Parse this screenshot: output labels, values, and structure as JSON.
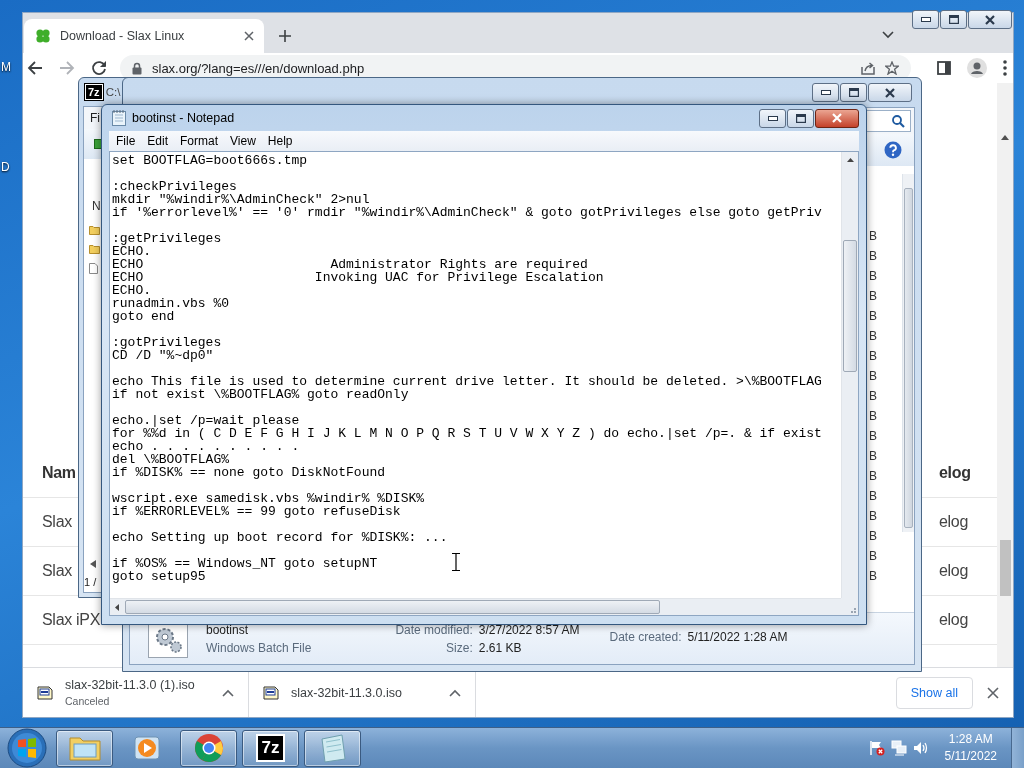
{
  "desktop": {
    "icon_labels": [
      "M",
      "D"
    ]
  },
  "browser": {
    "tab": {
      "title": "Download - Slax Linux",
      "selected": true
    },
    "url": "slax.org/?lang=es///en/download.php",
    "page": {
      "columns": [
        "Nam",
        "elog"
      ],
      "rows": [
        [
          "Slax",
          "elog"
        ],
        [
          "Slax",
          "elog"
        ],
        [
          "Slax iPX",
          "elog"
        ]
      ]
    },
    "downloads": [
      {
        "filename": "slax-32bit-11.3.0 (1).iso",
        "status": "Canceled"
      },
      {
        "filename": "slax-32bit-11.3.0.iso"
      }
    ],
    "show_all": "Show all"
  },
  "archive_window": {
    "logo": "7z",
    "title": "C:\\",
    "menu": [
      "Fi"
    ],
    "list_header": "N",
    "size_cells": [
      "B",
      "B",
      "B",
      "B",
      "B",
      "B",
      "B",
      "B",
      "B",
      "B",
      "B",
      "B",
      "B",
      "B",
      "B",
      "B",
      "B",
      "B"
    ],
    "status": "1 /",
    "details": {
      "name": "bootinst",
      "type": "Windows Batch File",
      "date_modified_label": "Date modified:",
      "date_modified": "3/27/2022 8:57 AM",
      "date_created_label": "Date created:",
      "date_created": "5/11/2022 1:28 AM",
      "size_label": "Size:",
      "size": "2.61 KB"
    }
  },
  "notepad": {
    "title": "bootinst - Notepad",
    "menu": [
      "File",
      "Edit",
      "Format",
      "View",
      "Help"
    ],
    "blocks": [
      [
        "set BOOTFLAG=boot666s.tmp"
      ],
      [
        ":checkPrivileges",
        "mkdir \"%windir%\\AdminCheck\" 2>nul",
        "if '%errorlevel%' == '0' rmdir \"%windir%\\AdminCheck\" & goto gotPrivileges else goto getPriv"
      ],
      [
        ":getPrivileges",
        "ECHO.",
        "ECHO                        Administrator Rights are required",
        "ECHO                      Invoking UAC for Privilege Escalation",
        "ECHO.",
        "runadmin.vbs %0",
        "goto end"
      ],
      [
        ":gotPrivileges",
        "CD /D \"%~dp0\""
      ],
      [
        "echo This file is used to determine current drive letter. It should be deleted. >\\%BOOTFLAG",
        "if not exist \\%BOOTFLAG% goto readOnly"
      ],
      [
        "echo.|set /p=wait please",
        "for %%d in ( C D E F G H I J K L M N O P Q R S T U V W X Y Z ) do echo.|set /p=. & if exist",
        "echo . . . . . . . . . .",
        "del \\%BOOTFLAG%",
        "if %DISK% == none goto DiskNotFound"
      ],
      [
        "wscript.exe samedisk.vbs %windir% %DISK%",
        "if %ERRORLEVEL% == 99 goto refuseDisk"
      ],
      [
        "echo Setting up boot record for %DISK%: ..."
      ],
      [
        "if %OS% == Windows_NT goto setupNT",
        "goto setup95"
      ]
    ]
  },
  "taskbar": {
    "apps": [
      {
        "kind": "explorer",
        "running": true
      },
      {
        "kind": "media-player",
        "running": false
      },
      {
        "kind": "browser",
        "running": true
      },
      {
        "kind": "archiver",
        "running": true,
        "label": "7z"
      },
      {
        "kind": "notepad",
        "running": true
      }
    ],
    "clock": {
      "time": "1:28 AM",
      "date": "5/11/2022"
    }
  }
}
